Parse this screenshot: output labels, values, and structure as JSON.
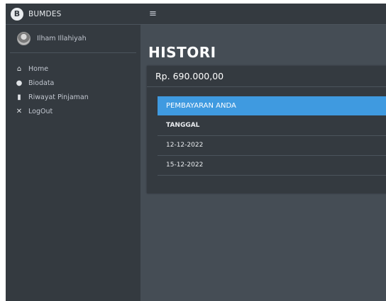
{
  "brand": {
    "logo": "B",
    "name": "BUMDES"
  },
  "user": {
    "name": "Ilham Illahiyah"
  },
  "sidebar": {
    "items": [
      {
        "icon": "home-icon",
        "glyph": "⌂",
        "label": "Home"
      },
      {
        "icon": "user-icon",
        "glyph": "●",
        "label": "Biodata"
      },
      {
        "icon": "file-icon",
        "glyph": "▮",
        "label": "Riwayat Pinjaman"
      },
      {
        "icon": "times-icon",
        "glyph": "✕",
        "label": "LogOut"
      }
    ]
  },
  "topbar": {
    "menu_glyph": "≡"
  },
  "page": {
    "title": "HISTORI"
  },
  "card": {
    "amount": "Rp. 690.000,00",
    "table_title": "PEMBAYARAN ANDA",
    "columns": [
      "TANGGAL"
    ],
    "rows": [
      [
        "12-12-2022"
      ],
      [
        "15-12-2022"
      ]
    ]
  }
}
